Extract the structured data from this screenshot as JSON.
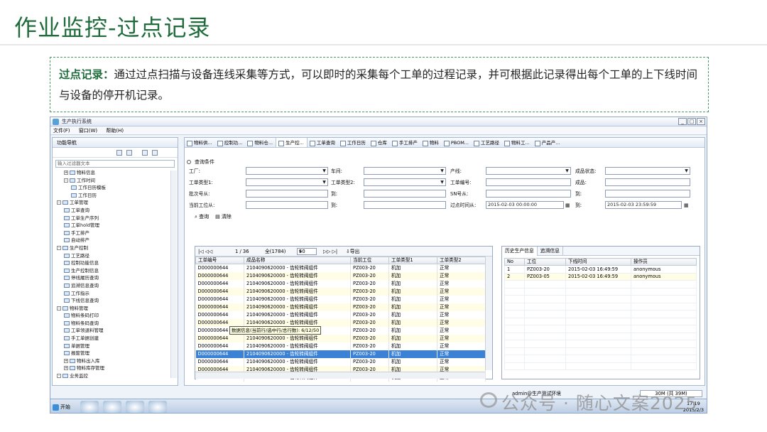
{
  "slide": {
    "title": "作业监控-过点记录",
    "intro_label": "过点记录：",
    "intro_text": "通过过点扫描与设备连线采集等方式，可以即时的采集每个工单的过程记录，并可根据此记录得出每个工单的上下线时间与设备的停开机记录。"
  },
  "window": {
    "title": "生产执行系统",
    "menu": [
      "文件(F)",
      "窗口(W)",
      "帮助(H)"
    ]
  },
  "nav": {
    "title": "功能导航",
    "filter_placeholder": "输入过滤器文本",
    "tree": [
      {
        "level": 1,
        "toggle": "+",
        "label": "物料信息"
      },
      {
        "level": 1,
        "toggle": "-",
        "label": "工作时间"
      },
      {
        "level": 2,
        "toggle": "",
        "label": "工作日历模板"
      },
      {
        "level": 2,
        "toggle": "",
        "label": "工作日历"
      },
      {
        "level": 0,
        "toggle": "-",
        "label": "工单管理"
      },
      {
        "level": 1,
        "toggle": "",
        "label": "工单查询"
      },
      {
        "level": 1,
        "toggle": "",
        "label": "工单生产序列"
      },
      {
        "level": 1,
        "toggle": "",
        "label": "工单hold管理"
      },
      {
        "level": 1,
        "toggle": "",
        "label": "手工排产"
      },
      {
        "level": 1,
        "toggle": "",
        "label": "自动排产"
      },
      {
        "level": 0,
        "toggle": "-",
        "label": "生产控制"
      },
      {
        "level": 1,
        "toggle": "",
        "label": "工艺路径"
      },
      {
        "level": 1,
        "toggle": "",
        "label": "控制功能信息"
      },
      {
        "level": 1,
        "toggle": "",
        "label": "生产控制信息"
      },
      {
        "level": 1,
        "toggle": "",
        "label": "停线履历查询"
      },
      {
        "level": 1,
        "toggle": "",
        "label": "追溯信息查询"
      },
      {
        "level": 1,
        "toggle": "",
        "label": "工作指示"
      },
      {
        "level": 1,
        "toggle": "",
        "label": "下线信息查询"
      },
      {
        "level": 0,
        "toggle": "-",
        "label": "物料管理"
      },
      {
        "level": 1,
        "toggle": "",
        "label": "物料条码打印"
      },
      {
        "level": 1,
        "toggle": "",
        "label": "物料条码查询"
      },
      {
        "level": 1,
        "toggle": "",
        "label": "工单领退料管理"
      },
      {
        "level": 1,
        "toggle": "",
        "label": "手工单据创建"
      },
      {
        "level": 1,
        "toggle": "",
        "label": "单据管理"
      },
      {
        "level": 1,
        "toggle": "",
        "label": "报废管理"
      },
      {
        "level": 1,
        "toggle": "+",
        "label": "物料出入库"
      },
      {
        "level": 1,
        "toggle": "+",
        "label": "物料库存管理"
      },
      {
        "level": 0,
        "toggle": "-",
        "label": "业务监控"
      }
    ]
  },
  "tabs": [
    "物料供...",
    "控制功...",
    "物料仓...",
    "生产控...",
    "工单查询",
    "工作日历",
    "仓库",
    "手工排产",
    "物料",
    "PBOM...",
    "工艺路径",
    "物料工...",
    "产品产..."
  ],
  "active_tab": 3,
  "query": {
    "heading": "查询条件",
    "labels": {
      "factory": "工厂:",
      "workshop": "车间:",
      "line": "产线:",
      "product_status": "成品状态:",
      "wo_type1": "工单类型1:",
      "wo_type2": "工单类型2:",
      "wo_no": "工单编号:",
      "product": "成品:",
      "batch_from": "批次号从:",
      "to1": "到:",
      "sn_from": "SN号从:",
      "to2": "到:",
      "station_from": "当前工位从:",
      "to3": "到:",
      "pass_time_from": "过点时间从:",
      "to4": "到:"
    },
    "pass_time_from": "2015-02-03 00:00:00",
    "pass_time_to": "2015-02-03 23:59:59",
    "search_label": "查询",
    "clear_label": "清除"
  },
  "pager": {
    "page": "1 / 36",
    "total": "全(1784)",
    "page_size": "50",
    "export_label": "导出"
  },
  "grid": {
    "columns": [
      "工单编号",
      "成品名称",
      "当前工位",
      "工单类型1",
      "工单类型2"
    ],
    "rows": [
      [
        "D000000644",
        "2104090620000 - 齿轮转阀组件",
        "PZ003-20",
        "机加",
        "正常"
      ],
      [
        "D000000644",
        "2104090620000 - 齿轮转阀组件",
        "PZ003-20",
        "机加",
        "正常"
      ],
      [
        "D000000644",
        "2104090620000 - 齿轮转阀组件",
        "PZ003-20",
        "机加",
        "正常"
      ],
      [
        "D000000644",
        "2104090620000 - 齿轮转阀组件",
        "PZ003-20",
        "机加",
        "正常"
      ],
      [
        "D000000644",
        "2104090620000 - 齿轮转阀组件",
        "PZ003-20",
        "机加",
        "正常"
      ],
      [
        "D000000644",
        "2104090620000 - 齿轮转阀组件",
        "PZ003-20",
        "机加",
        "正常"
      ],
      [
        "D000000644",
        "2104090620000 - 齿轮转阀组件",
        "PZ003-20",
        "机加",
        "正常"
      ],
      [
        "D000000644",
        "2104090620000 - 齿轮转阀组件",
        "PZ003-20",
        "机加",
        "正常"
      ],
      [
        "D000000644",
        "2104090620000 - 齿轮转阀组件",
        "PZ003-20",
        "机加",
        "正常"
      ],
      [
        "D000000644",
        "2104090620000 - 齿轮转阀组件",
        "PZ003-20",
        "机加",
        "正常"
      ],
      [
        "D000000644",
        "2104090620000 - 齿轮转阀组件",
        "PZ003-20",
        "机加",
        "正常"
      ],
      [
        "D000000644",
        "2104090620000 - 齿轮转阀组件",
        "PZ003-20",
        "机加",
        "正常"
      ],
      [
        "D000000644",
        "2104090620000 - 齿轮转阀组件",
        "PZ003-20",
        "机加",
        "正常"
      ],
      [
        "D000000644",
        "2104090620000 - 齿轮转阀组件",
        "PZ003-20",
        "机加",
        "正常"
      ],
      [
        "D000000644",
        "2104090620000 - 齿轮转阀组件",
        "PZ003-20",
        "机加",
        "正常"
      ]
    ],
    "selected_row": 11,
    "tooltip": "数据信息(当前行/选中行/总行数): 6/12/50"
  },
  "history": {
    "tabs": [
      "历史生产信息",
      "追溯信息"
    ],
    "columns": [
      "No",
      "工位",
      "下线时间",
      "操作员"
    ],
    "rows": [
      [
        "1",
        "PZ003-20",
        "2015-02-03 16:49:59",
        "anonymous"
      ],
      [
        "2",
        "PZ003-05",
        "2015-02-03 16:49:59",
        "anonymous"
      ]
    ]
  },
  "status": {
    "user": "admin@生产测试环境",
    "memory": "30M (共 39M)"
  },
  "taskbar": {
    "start": "开始",
    "time": "17:19",
    "date": "2015/2/3"
  },
  "watermark": "公众号 · 随心文案2025",
  "colors": {
    "title_green": "#1f6b3c",
    "selected_row": "#3b82d6",
    "alt_row": "#fffde6"
  }
}
